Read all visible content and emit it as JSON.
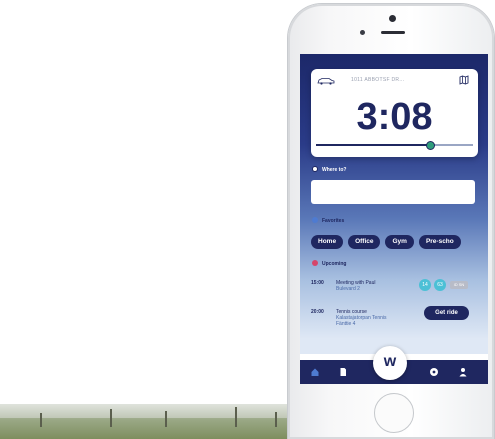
{
  "card": {
    "address": "1011 ABBOTSF DR...",
    "time": "3:08",
    "slider_value": 0.72
  },
  "sections": {
    "where": "Where to?",
    "favorites": "Favorites",
    "upcoming": "Upcoming"
  },
  "where_input": {
    "value": ""
  },
  "favorites": [
    "Home",
    "Office",
    "Gym",
    "Pre-scho"
  ],
  "events": [
    {
      "time": "15:00",
      "title": "Meeting with Paul",
      "subtitle": "Bulevard 2",
      "badges": [
        "14",
        "63"
      ],
      "tag": "ID SN"
    },
    {
      "time": "20:00",
      "title": "Tennis course",
      "subtitle_lines": [
        "Kalastajatorpan Tennis",
        "Fänttie 4"
      ],
      "action": "Get ride"
    }
  ],
  "fab_label": "w",
  "colors": {
    "navy": "#1f2760",
    "accent_green": "#2f9d7c",
    "badge_teal": "#4cc0d6",
    "dot_where": "#ffffff",
    "dot_favorites": "#4e7bd1",
    "dot_upcoming": "#d6456a"
  },
  "icons": {
    "tab_home": "home-icon",
    "tab_doc": "document-icon",
    "tab_football": "football-icon",
    "tab_profile": "person-icon"
  }
}
